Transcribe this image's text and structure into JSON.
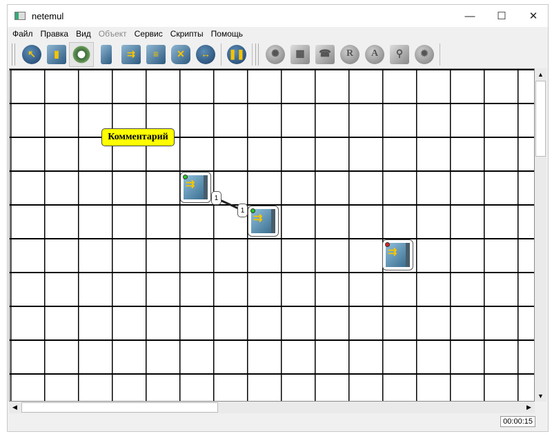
{
  "window": {
    "title": "netemul"
  },
  "menu": [
    "Файл",
    "Правка",
    "Вид",
    "Объект",
    "Сервис",
    "Скрипты",
    "Помощь"
  ],
  "toolbar": {
    "main": [
      {
        "name": "select-tool",
        "glyph": "↖"
      },
      {
        "name": "note-tool",
        "glyph": "▮"
      },
      {
        "name": "cable-tool",
        "glyph": "◎"
      },
      {
        "name": "computer-tool",
        "glyph": "▯"
      },
      {
        "name": "switch-tool",
        "glyph": "⇉"
      },
      {
        "name": "hub-tool",
        "glyph": "≡"
      },
      {
        "name": "router-tool",
        "glyph": "✕"
      },
      {
        "name": "send-tool",
        "glyph": "↔"
      }
    ],
    "play": {
      "name": "pause-button",
      "glyph": "❚❚"
    },
    "device": [
      {
        "name": "settings",
        "glyph": "✺"
      },
      {
        "name": "interfaces",
        "glyph": "▦"
      },
      {
        "name": "arp",
        "glyph": "☎"
      },
      {
        "name": "routes",
        "glyph": "R"
      },
      {
        "name": "addresses",
        "glyph": "A"
      },
      {
        "name": "sniffer",
        "glyph": "⚲"
      },
      {
        "name": "programs",
        "glyph": "✹"
      }
    ]
  },
  "canvas": {
    "comment": "Комментарий",
    "devices": [
      {
        "status": "green"
      },
      {
        "status": "green"
      },
      {
        "status": "red"
      }
    ],
    "link": {
      "port_a": "1",
      "port_b": "1"
    }
  },
  "statusbar": {
    "time": "00:00:15"
  },
  "colors": {
    "green": "#22cc22",
    "red": "#dd2222",
    "comment_bg": "#ffff00"
  }
}
